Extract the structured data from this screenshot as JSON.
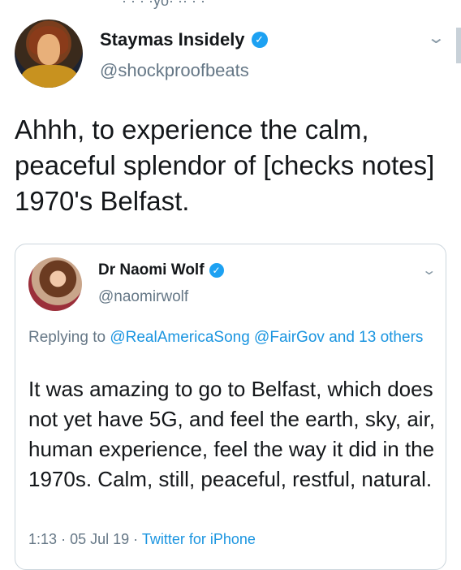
{
  "header_fragment": "· · · ·yo· ·· · ·",
  "tweet": {
    "author_name": "Staymas Insidely",
    "author_handle": "@shockproofbeats",
    "text": "Ahhh, to experience the calm, peaceful splendor of [checks notes] 1970's Belfast."
  },
  "quoted_tweet": {
    "author_name": "Dr Naomi Wolf",
    "author_handle": "@naomirwolf",
    "replying_prefix": "Replying to",
    "reply_mention_1": "@RealAmericaSong",
    "reply_mention_2": "@FairGov",
    "reply_and": "and",
    "reply_others": "13 others",
    "text": "It was amazing to go to Belfast, which does not yet have 5G, and feel the earth, sky, air, human experience, feel the way it did in the 1970s. Calm, still, peaceful, restful, natural.",
    "time": "1:13",
    "date": "05 Jul 19",
    "source": "Twitter for iPhone"
  },
  "icons": {
    "verified": "verified-badge-icon",
    "more": "chevron-down-icon"
  },
  "colors": {
    "link": "#1b95e0",
    "verified": "#1da1f2",
    "muted": "#657786"
  }
}
